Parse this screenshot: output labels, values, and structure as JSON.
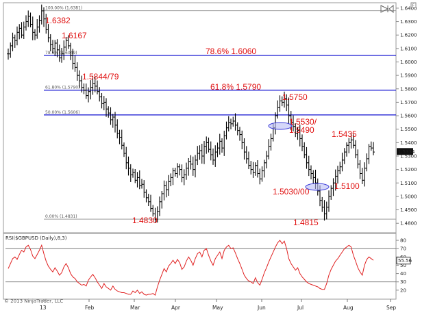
{
  "chart_data": {
    "type": "ohlc",
    "ylim": [
      1.475,
      1.642
    ],
    "yticks": [
      "1.6400",
      "1.6300",
      "1.6200",
      "1.6100",
      "1.6000",
      "1.5900",
      "1.5800",
      "1.5700",
      "1.5600",
      "1.5500",
      "1.5400",
      "1.5300",
      "1.5200",
      "1.5100",
      "1.5000",
      "1.4900",
      "1.4800"
    ],
    "ytick_values": [
      1.64,
      1.63,
      1.62,
      1.61,
      1.6,
      1.59,
      1.58,
      1.57,
      1.56,
      1.55,
      1.54,
      1.53,
      1.52,
      1.51,
      1.5,
      1.49,
      1.48
    ],
    "xlabels": [
      "13",
      "Feb",
      "Mar",
      "Apr",
      "May",
      "Jun",
      "Jul",
      "Aug",
      "Sep"
    ],
    "current_price": "1.5334",
    "fib_levels": [
      {
        "label": "100.00% (1.6381)",
        "value": 1.6381
      },
      {
        "label": "78.6% (1.6049)",
        "value": 1.6049
      },
      {
        "label": "61.80% (1.5790)",
        "value": 1.579
      },
      {
        "label": "50.00% (1.5606)",
        "value": 1.5606
      },
      {
        "label": "0.00% (1.4831)",
        "value": 1.4831
      }
    ],
    "horizontal_lines": [
      1.6049,
      1.579,
      1.5606
    ],
    "annotations": [
      "1.6382",
      "1.6167",
      "78.6% 1.6060",
      "1.5844/79",
      "61.8% 1.5790",
      "1.5750",
      "1.5530/",
      "1.5490",
      "1.5435",
      "1.5030/00",
      "1.5100",
      "1.4830",
      "1.4815"
    ],
    "series": [
      {
        "name": "GBPUSD Daily",
        "values": [
          1.606,
          1.612,
          1.618,
          1.616,
          1.622,
          1.625,
          1.62,
          1.626,
          1.63,
          1.634,
          1.628,
          1.622,
          1.62,
          1.626,
          1.631,
          1.638,
          1.632,
          1.624,
          1.618,
          1.613,
          1.61,
          1.614,
          1.609,
          1.603,
          1.606,
          1.611,
          1.616,
          1.612,
          1.605,
          1.599,
          1.596,
          1.59,
          1.586,
          1.581,
          1.579,
          1.575,
          1.578,
          1.581,
          1.584,
          1.582,
          1.578,
          1.574,
          1.569,
          1.57,
          1.565,
          1.562,
          1.557,
          1.559,
          1.553,
          1.547,
          1.544,
          1.538,
          1.532,
          1.525,
          1.521,
          1.516,
          1.518,
          1.512,
          1.514,
          1.508,
          1.509,
          1.503,
          1.499,
          1.496,
          1.491,
          1.487,
          1.483,
          1.489,
          1.496,
          1.502,
          1.508,
          1.505,
          1.511,
          1.514,
          1.519,
          1.517,
          1.522,
          1.52,
          1.514,
          1.516,
          1.521,
          1.526,
          1.524,
          1.52,
          1.527,
          1.532,
          1.534,
          1.53,
          1.537,
          1.54,
          1.535,
          1.531,
          1.527,
          1.533,
          1.536,
          1.541,
          1.536,
          1.545,
          1.551,
          1.555,
          1.554,
          1.556,
          1.553,
          1.549,
          1.546,
          1.54,
          1.533,
          1.528,
          1.523,
          1.52,
          1.518,
          1.523,
          1.517,
          1.513,
          1.519,
          1.525,
          1.53,
          1.537,
          1.543,
          1.551,
          1.56,
          1.566,
          1.571,
          1.57,
          1.573,
          1.568,
          1.56,
          1.555,
          1.552,
          1.547,
          1.549,
          1.543,
          1.537,
          1.531,
          1.525,
          1.52,
          1.517,
          1.514,
          1.51,
          1.504,
          1.497,
          1.492,
          1.487,
          1.492,
          1.5,
          1.506,
          1.51,
          1.515,
          1.519,
          1.522,
          1.527,
          1.533,
          1.538,
          1.54,
          1.542,
          1.538,
          1.531,
          1.524,
          1.517,
          1.512,
          1.521,
          1.528,
          1.537,
          1.536,
          1.533
        ]
      }
    ],
    "rsi": {
      "label": "RSI($GBPUSD (Daily),8,3)",
      "ylim": [
        10,
        85
      ],
      "yticks": [
        "80",
        "70",
        "60",
        "50",
        "40",
        "30",
        "20"
      ],
      "ytick_values": [
        80,
        70,
        60,
        50,
        40,
        30,
        20
      ],
      "levels": [
        70,
        30
      ],
      "value_label": "55.56",
      "values": [
        46,
        52,
        58,
        60,
        57,
        63,
        68,
        66,
        72,
        74,
        69,
        61,
        58,
        63,
        68,
        74,
        64,
        55,
        49,
        45,
        42,
        47,
        43,
        38,
        41,
        48,
        52,
        47,
        40,
        36,
        34,
        30,
        28,
        26,
        27,
        25,
        32,
        36,
        39,
        35,
        30,
        26,
        22,
        28,
        24,
        22,
        20,
        25,
        21,
        19,
        18,
        17,
        17,
        16,
        15,
        15,
        19,
        17,
        20,
        16,
        18,
        15,
        14,
        15,
        15,
        16,
        14,
        24,
        32,
        39,
        46,
        42,
        49,
        52,
        56,
        52,
        57,
        53,
        45,
        48,
        55,
        60,
        56,
        50,
        58,
        64,
        66,
        60,
        68,
        70,
        62,
        55,
        50,
        58,
        62,
        66,
        58,
        68,
        72,
        74,
        70,
        71,
        65,
        58,
        52,
        45,
        38,
        34,
        31,
        30,
        28,
        35,
        29,
        26,
        33,
        41,
        47,
        54,
        60,
        66,
        72,
        77,
        80,
        76,
        79,
        70,
        58,
        52,
        48,
        44,
        47,
        40,
        36,
        33,
        30,
        28,
        27,
        26,
        25,
        24,
        22,
        21,
        21,
        28,
        38,
        45,
        50,
        55,
        58,
        62,
        66,
        70,
        72,
        74,
        72,
        62,
        55,
        47,
        42,
        38,
        50,
        57,
        60,
        58,
        56
      ]
    },
    "copyright": "© 2013 NinjaTrader, LLC",
    "ui_icons": [
      "collapse-arrows-icon",
      "scroll-right-icon",
      "scroll-left-icon"
    ]
  }
}
